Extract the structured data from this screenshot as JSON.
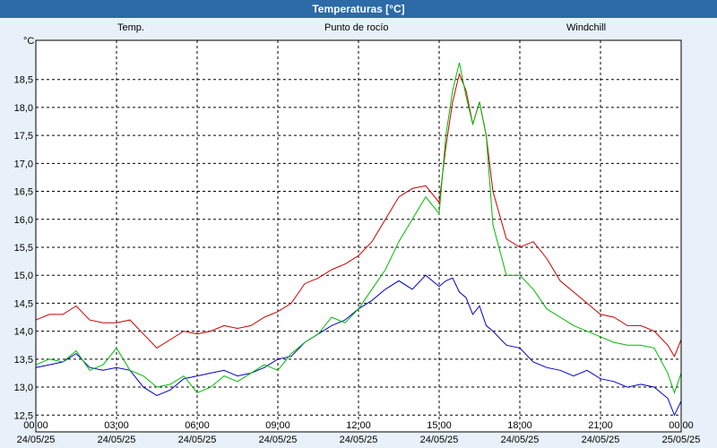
{
  "chart_data": {
    "type": "line",
    "title": "Temperaturas [°C]",
    "unit": "°C",
    "ylim": [
      12.2,
      19.2
    ],
    "yticks": [
      "12,5",
      "13,0",
      "13,5",
      "14,0",
      "14,5",
      "15,0",
      "15,5",
      "16,0",
      "16,5",
      "17,0",
      "17,5",
      "18,0",
      "18,5"
    ],
    "yticks_values": [
      12.5,
      13.0,
      13.5,
      14.0,
      14.5,
      15.0,
      15.5,
      16.0,
      16.5,
      17.0,
      17.5,
      18.0,
      18.5
    ],
    "x_hours": [
      0,
      0.5,
      1,
      1.5,
      2,
      2.5,
      3,
      3.5,
      4,
      4.5,
      5,
      5.5,
      6,
      6.5,
      7,
      7.5,
      8,
      8.5,
      9,
      9.5,
      10,
      10.5,
      11,
      11.5,
      12,
      12.5,
      13,
      13.5,
      14,
      14.5,
      15,
      15.25,
      15.5,
      15.75,
      16,
      16.25,
      16.5,
      16.75,
      17,
      17.5,
      18,
      18.5,
      19,
      19.5,
      20,
      20.5,
      21,
      21.5,
      22,
      22.5,
      23,
      23.5,
      23.75,
      24
    ],
    "xticks": [
      {
        "time": "00:00",
        "date": "24/05/25"
      },
      {
        "time": "03:00",
        "date": "24/05/25"
      },
      {
        "time": "06:00",
        "date": "24/05/25"
      },
      {
        "time": "09:00",
        "date": "24/05/25"
      },
      {
        "time": "12:00",
        "date": "24/05/25"
      },
      {
        "time": "15:00",
        "date": "24/05/25"
      },
      {
        "time": "18:00",
        "date": "24/05/25"
      },
      {
        "time": "21:00",
        "date": "24/05/25"
      },
      {
        "time": "00:00",
        "date": "25/05/25"
      }
    ],
    "series": [
      {
        "name": "Temp.",
        "color": "#cc0000",
        "values": [
          14.2,
          14.3,
          14.3,
          14.45,
          14.2,
          14.15,
          14.15,
          14.2,
          13.95,
          13.7,
          13.85,
          14.0,
          13.95,
          14.0,
          14.1,
          14.05,
          14.1,
          14.25,
          14.35,
          14.5,
          14.85,
          14.95,
          15.1,
          15.2,
          15.35,
          15.6,
          16.0,
          16.4,
          16.55,
          16.6,
          16.3,
          17.3,
          18.1,
          18.6,
          18.3,
          17.7,
          18.1,
          17.5,
          16.5,
          15.65,
          15.5,
          15.6,
          15.3,
          14.9,
          14.7,
          14.5,
          14.3,
          14.25,
          14.1,
          14.1,
          14.0,
          13.75,
          13.55,
          13.85
        ]
      },
      {
        "name": "Punto de rocío",
        "color": "#0000cc",
        "values": [
          13.35,
          13.4,
          13.45,
          13.6,
          13.35,
          13.3,
          13.35,
          13.3,
          13.0,
          12.85,
          12.95,
          13.15,
          13.2,
          13.25,
          13.3,
          13.2,
          13.25,
          13.35,
          13.5,
          13.55,
          13.8,
          13.95,
          14.1,
          14.2,
          14.4,
          14.55,
          14.75,
          14.9,
          14.75,
          15.0,
          14.8,
          14.9,
          14.95,
          14.7,
          14.6,
          14.3,
          14.45,
          14.1,
          14.0,
          13.75,
          13.7,
          13.45,
          13.35,
          13.3,
          13.2,
          13.3,
          13.15,
          13.1,
          13.0,
          13.05,
          13.0,
          12.8,
          12.5,
          12.75
        ]
      },
      {
        "name": "Windchill",
        "color": "#00bb00",
        "values": [
          13.4,
          13.5,
          13.45,
          13.65,
          13.3,
          13.4,
          13.7,
          13.3,
          13.2,
          13.0,
          13.05,
          13.2,
          12.9,
          13.0,
          13.2,
          13.1,
          13.25,
          13.4,
          13.3,
          13.6,
          13.8,
          13.95,
          14.25,
          14.15,
          14.4,
          14.75,
          15.1,
          15.6,
          16.0,
          16.4,
          16.1,
          17.5,
          18.3,
          18.8,
          18.2,
          17.7,
          18.1,
          17.5,
          15.9,
          15.0,
          15.0,
          14.75,
          14.4,
          14.25,
          14.1,
          14.0,
          13.9,
          13.8,
          13.75,
          13.75,
          13.7,
          13.25,
          12.9,
          13.25
        ]
      }
    ]
  }
}
